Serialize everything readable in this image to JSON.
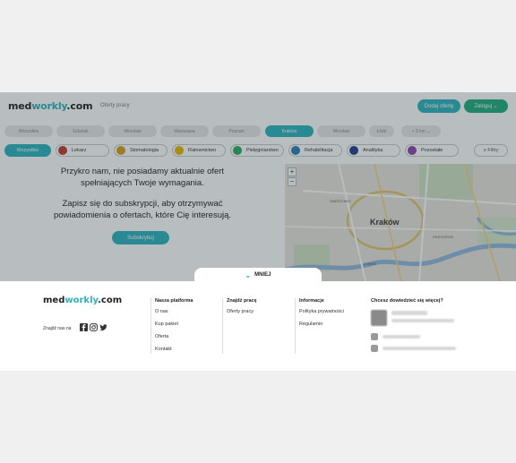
{
  "header": {
    "logo_part1": "med",
    "logo_part2": "workly",
    "logo_part3": ".com",
    "nav_link": "Oferty pracy",
    "post_offer_button": "Dodaj ofertę",
    "login_button": "Zaloguj ⌄"
  },
  "cities": [
    {
      "label": "Wszystkie",
      "active": false
    },
    {
      "label": "Gdańsk",
      "active": false
    },
    {
      "label": "Wrocław",
      "active": false
    },
    {
      "label": "Warszawa",
      "active": false
    },
    {
      "label": "Poznań",
      "active": false
    },
    {
      "label": "Kraków",
      "active": true
    },
    {
      "label": "Wrocław",
      "active": false
    },
    {
      "label": "Łódź",
      "active": false
    },
    {
      "label": "+ 0 km ⌄",
      "active": false
    }
  ],
  "categories": [
    {
      "label": "Wszystkie",
      "color": "#2ab3bf"
    },
    {
      "label": "Lekarz",
      "color": "#c0392b"
    },
    {
      "label": "Stomatologia",
      "color": "#d4a017"
    },
    {
      "label": "Ratownictwo",
      "color": "#e6b800"
    },
    {
      "label": "Pielęgniarstwo",
      "color": "#27ae60"
    },
    {
      "label": "Rehabilitacja",
      "color": "#2980b9"
    },
    {
      "label": "Analityka",
      "color": "#1a3e8c"
    },
    {
      "label": "Pozostałe",
      "color": "#8e44ad"
    }
  ],
  "filters_label": "≡ Filtry",
  "no_results": {
    "line1": "Przykro nam, nie posiadamy aktualnie ofert",
    "line2": "spełniających Twoje wymagania.",
    "line3": "Zapisz się do subskrypcji, aby otrzymywać",
    "line4": "powiadomienia o ofertach, które Cię interesują.",
    "subscribe_button": "Subskrybuj"
  },
  "map": {
    "city_label": "Kraków",
    "zoom_in": "+",
    "zoom_out": "−",
    "district_labels": [
      "ZWIERZYNIEC",
      "DĘBNIKI",
      "GRZEGÓRZKI"
    ]
  },
  "footer": {
    "toggle_label": "MNIEJ",
    "logo_part1": "med",
    "logo_part2": "workly",
    "logo_part3": ".com",
    "social_label": "Znajdź nas na",
    "columns": [
      {
        "title": "Nasza platforma",
        "items": [
          "O nas",
          "Kup pakiet",
          "Oferta",
          "Kontakt"
        ]
      },
      {
        "title": "Znajdź pracę",
        "items": [
          "Oferty pracy"
        ]
      },
      {
        "title": "Informacje",
        "items": [
          "Polityka prywatności",
          "Regulamin"
        ]
      }
    ],
    "contact_title": "Chcesz dowiedzieć się więcej?"
  },
  "colors": {
    "accent": "#2ab3bf",
    "login": "#1fae7e"
  }
}
